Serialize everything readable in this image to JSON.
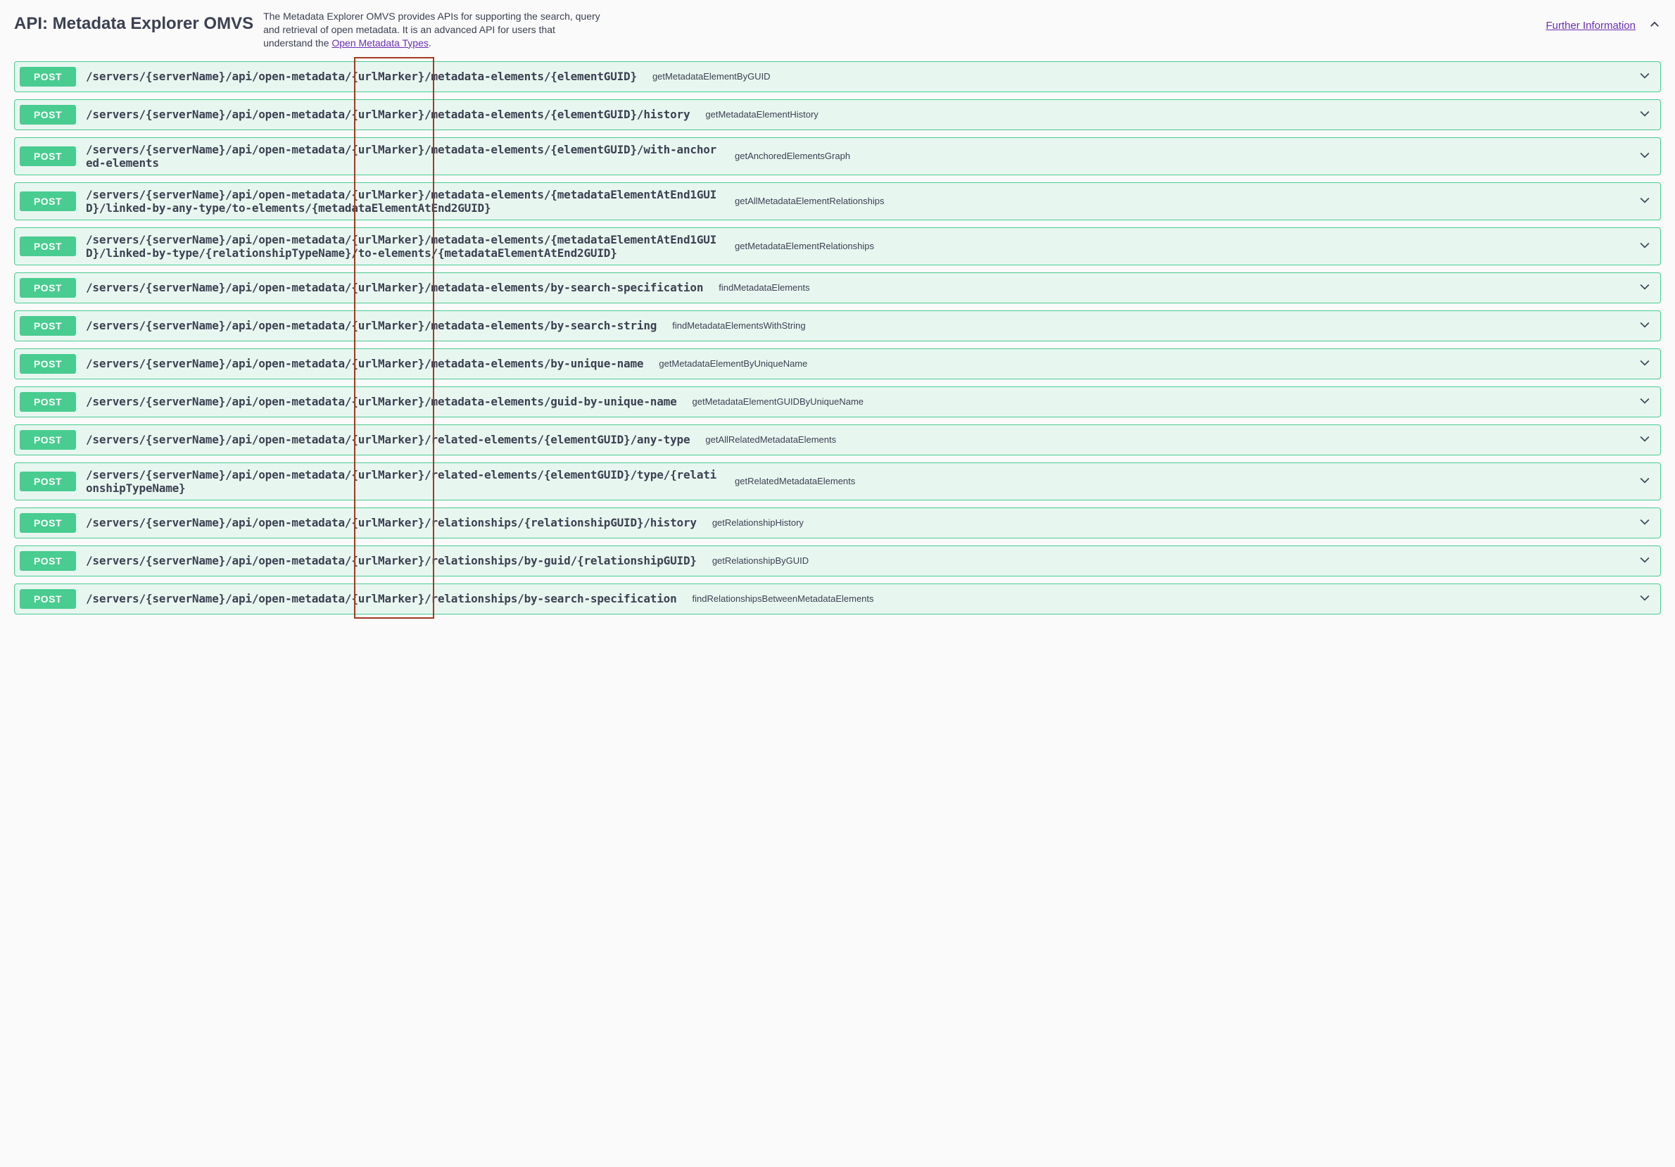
{
  "header": {
    "title": "API: Metadata Explorer OMVS",
    "desc_pre": "The Metadata Explorer OMVS provides APIs for supporting the search, query and retrieval of open metadata. It is an advanced API for users that understand the ",
    "desc_link": "Open Metadata Types",
    "desc_post": ".",
    "further": "Further Information"
  },
  "ops": [
    {
      "method": "POST",
      "path": "/servers/{serverName}/api/open-metadata/{urlMarker}/metadata-elements/{elementGUID}",
      "opid": "getMetadataElementByGUID"
    },
    {
      "method": "POST",
      "path": "/servers/{serverName}/api/open-metadata/{urlMarker}/metadata-elements/{elementGUID}/history",
      "opid": "getMetadataElementHistory"
    },
    {
      "method": "POST",
      "path": "/servers/{serverName}/api/open-metadata/{urlMarker}/metadata-elements/{elementGUID}/with-anchored-elements",
      "opid": "getAnchoredElementsGraph"
    },
    {
      "method": "POST",
      "path": "/servers/{serverName}/api/open-metadata/{urlMarker}/metadata-elements/{metadataElementAtEnd1GUID}/linked-by-any-type/to-elements/{metadataElementAtEnd2GUID}",
      "opid": "getAllMetadataElementRelationships"
    },
    {
      "method": "POST",
      "path": "/servers/{serverName}/api/open-metadata/{urlMarker}/metadata-elements/{metadataElementAtEnd1GUID}/linked-by-type/{relationshipTypeName}/to-elements/{metadataElementAtEnd2GUID}",
      "opid": "getMetadataElementRelationships"
    },
    {
      "method": "POST",
      "path": "/servers/{serverName}/api/open-metadata/{urlMarker}/metadata-elements/by-search-specification",
      "opid": "findMetadataElements"
    },
    {
      "method": "POST",
      "path": "/servers/{serverName}/api/open-metadata/{urlMarker}/metadata-elements/by-search-string",
      "opid": "findMetadataElementsWithString"
    },
    {
      "method": "POST",
      "path": "/servers/{serverName}/api/open-metadata/{urlMarker}/metadata-elements/by-unique-name",
      "opid": "getMetadataElementByUniqueName"
    },
    {
      "method": "POST",
      "path": "/servers/{serverName}/api/open-metadata/{urlMarker}/metadata-elements/guid-by-unique-name",
      "opid": "getMetadataElementGUIDByUniqueName"
    },
    {
      "method": "POST",
      "path": "/servers/{serverName}/api/open-metadata/{urlMarker}/related-elements/{elementGUID}/any-type",
      "opid": "getAllRelatedMetadataElements"
    },
    {
      "method": "POST",
      "path": "/servers/{serverName}/api/open-metadata/{urlMarker}/related-elements/{elementGUID}/type/{relationshipTypeName}",
      "opid": "getRelatedMetadataElements"
    },
    {
      "method": "POST",
      "path": "/servers/{serverName}/api/open-metadata/{urlMarker}/relationships/{relationshipGUID}/history",
      "opid": "getRelationshipHistory"
    },
    {
      "method": "POST",
      "path": "/servers/{serverName}/api/open-metadata/{urlMarker}/relationships/by-guid/{relationshipGUID}",
      "opid": "getRelationshipByGUID"
    },
    {
      "method": "POST",
      "path": "/servers/{serverName}/api/open-metadata/{urlMarker}/relationships/by-search-specification",
      "opid": "findRelationshipsBetweenMetadataElements"
    }
  ]
}
